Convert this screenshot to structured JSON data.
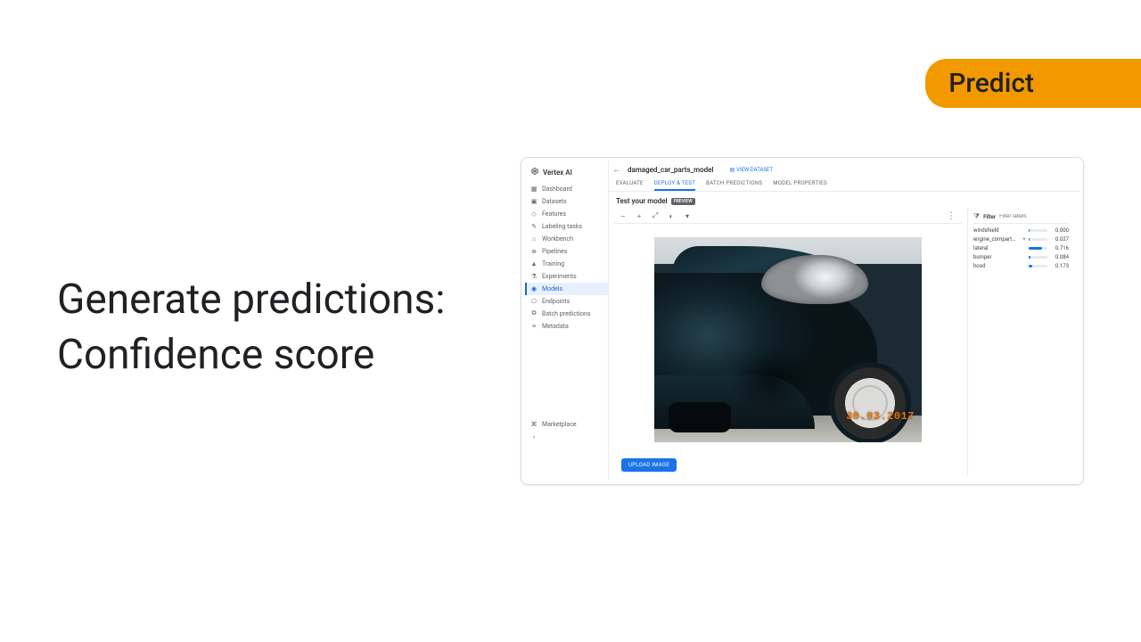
{
  "badge": {
    "label": "Predict"
  },
  "headline": {
    "line1": "Generate predictions:",
    "line2": "Confidence score"
  },
  "sidebar": {
    "product": "Vertex AI",
    "items": [
      {
        "label": "Dashboard",
        "icon": "dashboard-icon"
      },
      {
        "label": "Datasets",
        "icon": "datasets-icon"
      },
      {
        "label": "Features",
        "icon": "features-icon"
      },
      {
        "label": "Labeling tasks",
        "icon": "labeling-icon"
      },
      {
        "label": "Workbench",
        "icon": "workbench-icon"
      },
      {
        "label": "Pipelines",
        "icon": "pipelines-icon"
      },
      {
        "label": "Training",
        "icon": "training-icon"
      },
      {
        "label": "Experiments",
        "icon": "experiments-icon"
      },
      {
        "label": "Models",
        "icon": "models-icon",
        "active": true
      },
      {
        "label": "Endpoints",
        "icon": "endpoints-icon"
      },
      {
        "label": "Batch predictions",
        "icon": "batch-icon"
      },
      {
        "label": "Metadata",
        "icon": "metadata-icon"
      }
    ],
    "footer": {
      "label": "Marketplace",
      "icon": "marketplace-icon"
    }
  },
  "header": {
    "back": "←",
    "model_name": "damaged_car_parts_model",
    "view_dataset": "VIEW DATASET"
  },
  "tabs": [
    {
      "label": "EVALUATE"
    },
    {
      "label": "DEPLOY & TEST",
      "active": true
    },
    {
      "label": "BATCH PREDICTIONS"
    },
    {
      "label": "MODEL PROPERTIES"
    }
  ],
  "section": {
    "title": "Test your model",
    "pill": "PREVIEW"
  },
  "toolbar": {
    "zoom_out": "−",
    "zoom_in": "+",
    "fit": "⤢",
    "contrast": "◐",
    "dropdown": "▾",
    "more": "⋮"
  },
  "image": {
    "timestamp": "30.03.2017"
  },
  "upload_button": "UPLOAD IMAGE",
  "filter": {
    "title": "Filter",
    "placeholder": "Filter labels",
    "rows": [
      {
        "name": "windshield",
        "mark": "",
        "score": 0.0
      },
      {
        "name": "engine_compartment",
        "mark": "+",
        "score": 0.027
      },
      {
        "name": "lateral",
        "mark": "",
        "score": 0.716
      },
      {
        "name": "bumper",
        "mark": "",
        "score": 0.084
      },
      {
        "name": "hood",
        "mark": "",
        "score": 0.173
      }
    ]
  },
  "colors": {
    "accent": "#1a73e8",
    "badge": "#f29900"
  }
}
